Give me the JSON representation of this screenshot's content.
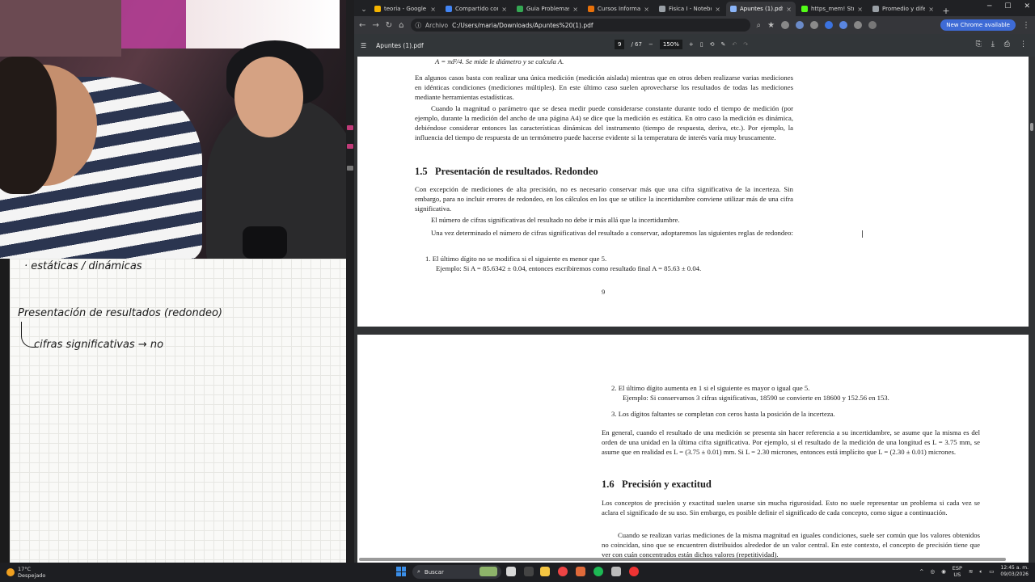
{
  "notes": {
    "line1": "· estáticas / dinámicas",
    "line2": "Presentación de resultados (redondeo)",
    "line3": "cifras significativas → no"
  },
  "browser": {
    "tabs": [
      {
        "label": "teoria - Google Driv",
        "color": "#f5b400"
      },
      {
        "label": "Compartido conmig",
        "color": "#4285f4"
      },
      {
        "label": "Guia Problemas Fisi",
        "color": "#34a853"
      },
      {
        "label": "Cursos Informatica",
        "color": "#e8710a"
      },
      {
        "label": "Fisica I - Notebook",
        "color": "#9aa0a6"
      },
      {
        "label": "Apuntes (1).pdf",
        "color": "#8ab4f8",
        "active": true
      },
      {
        "label": "https_mem! Stream",
        "color": "#53fc18"
      },
      {
        "label": "Promedio y diferen",
        "color": "#9aa0a6"
      }
    ],
    "url_chip": "Archivo",
    "url": "C:/Users/maria/Downloads/Apuntes%20(1).pdf",
    "update_label": "New Chrome available"
  },
  "pdf": {
    "title": "Apuntes (1).pdf",
    "page_current": "9",
    "page_total": "/ 67",
    "zoom": "150%",
    "page1": {
      "top_formula": "A = πd²/4. Se mide le diámetro y se calcula A.",
      "para1": "En algunos casos basta con realizar una única medición (medición aislada) mientras que en otros deben realizarse varias mediciones en idénticas condiciones (mediciones múltiples). En este último caso suelen aprovecharse los resultados de todas las mediciones mediante herramientas estadísticas.",
      "para2": "Cuando la magnitud o parámetro que se desea medir puede considerarse constante durante todo el tiempo de medición (por ejemplo, durante la medición del ancho de una página A4) se dice que la medición es estática. En otro caso la medición es dinámica, debiéndose considerar entonces las características dinámicas del instrumento (tiempo de respuesta, deriva, etc.). Por ejemplo, la influencia del tiempo de respuesta de un termómetro puede hacerse evidente si la temperatura de interés varía muy bruscamente.",
      "section_num": "1.5",
      "section_title": "Presentación de resultados. Redondeo",
      "para3": "Con excepción de mediciones de alta precisión, no es necesario conservar más que una cifra significativa de la incerteza. Sin embargo, para no incluir errores de redondeo, en los cálculos en los que se utilice la incertidumbre conviene utilizar más de una cifra significativa.",
      "para4": "El número de cifras significativas del resultado no debe ir más allá que la incertidumbre.",
      "para5": "Una vez determinado el número de cifras significativas del resultado a conservar, adoptaremos las siguientes reglas de redondeo:",
      "rule1": "1. El último dígito no se modifica si el siguiente es menor que 5.",
      "rule1_example": "Ejemplo: Si A = 85.6342 ± 0.04, entonces escribiremos como resultado final A = 85.63 ± 0.04.",
      "page_number": "9"
    },
    "page2": {
      "rule2": "2. El último dígito aumenta en 1 si el siguiente es mayor o igual que 5.",
      "rule2_example": "Ejemplo: Si conservamos 3 cifras significativas, 18590 se convierte en 18600 y 152.56 en 153.",
      "rule3": "3. Los dígitos faltantes se completan con ceros hasta la posición de la incerteza.",
      "para1": "En general, cuando el resultado de una medición se presenta sin hacer referencia a su incertidumbre, se asume que la misma es del orden de una unidad en la última cifra significativa. Por ejemplo, si el resultado de la medición de una longitud es L = 3.75 mm, se asume que en realidad es L = (3.75 ± 0.01) mm. Si L = 2.30 micrones, entonces está implícito que L = (2.30 ± 0.01) micrones.",
      "section_num": "1.6",
      "section_title": "Precisión y exactitud",
      "para2": "Los conceptos de precisión y exactitud suelen usarse sin mucha rigurosidad. Esto no suele representar un problema si cada vez se aclara el significado de su uso. Sin embargo, es posible definir el significado de cada concepto, como sigue a continuación.",
      "para3": "Cuando se realizan varias mediciones de la misma magnitud en iguales condiciones, suele ser común que los valores obtenidos no coincidan, sino que se encuentren distribuidos alrededor de un valor central. En este contexto, el concepto de precisión tiene que ver con cuán concentrados están dichos valores (repetitividad)."
    }
  },
  "taskbar": {
    "temp": "17°C",
    "weather": "Despejado",
    "search_label": "Buscar",
    "lang1": "ESP",
    "lang2": "US",
    "time": "12:45 a. m.",
    "date": "09/03/2026"
  }
}
